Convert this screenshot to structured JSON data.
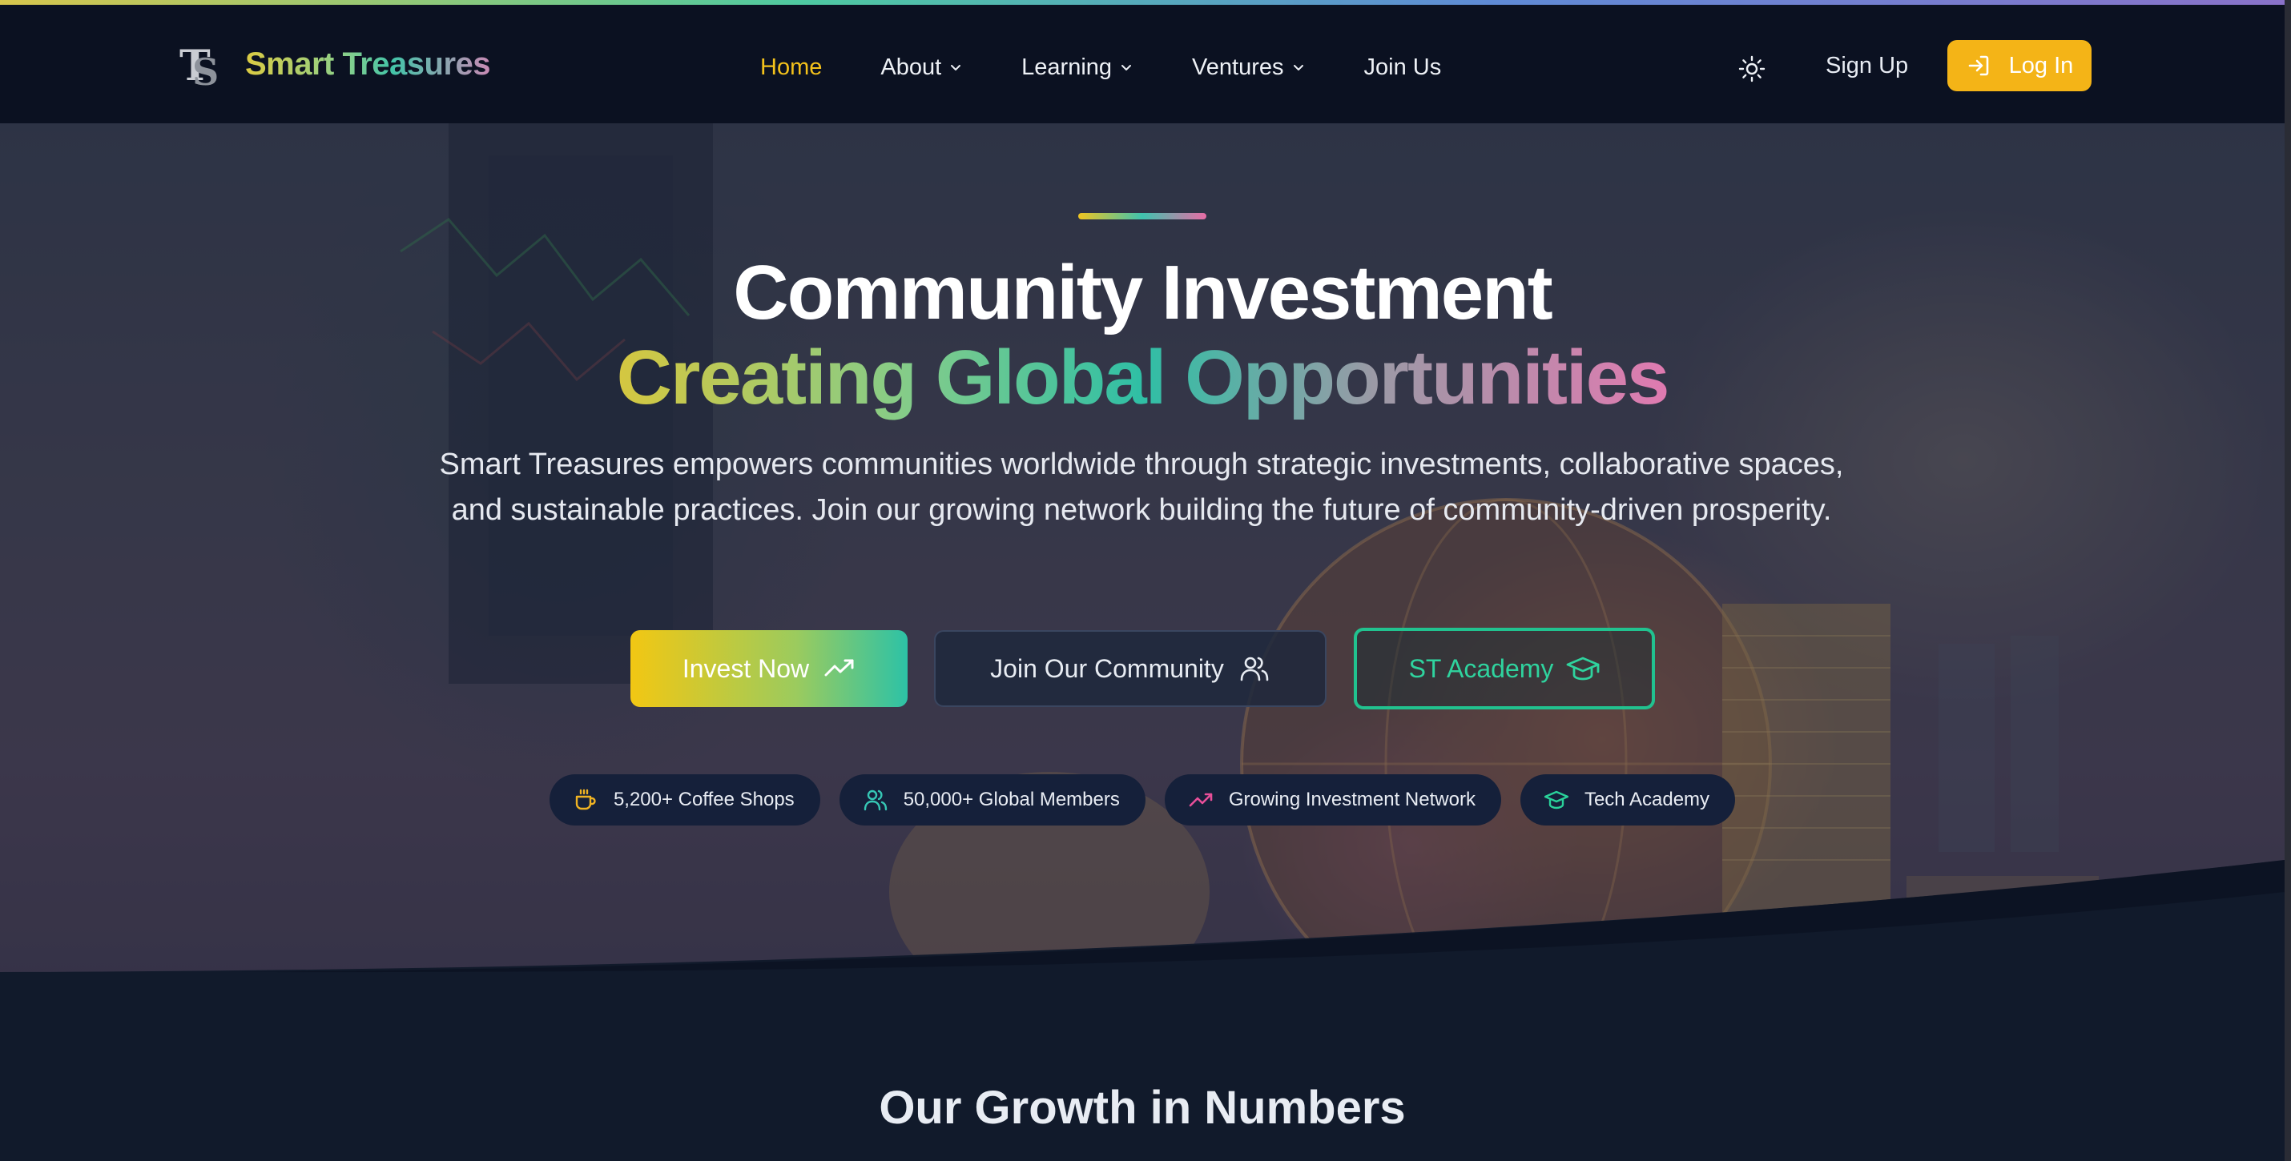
{
  "header": {
    "brand": "Smart Treasures",
    "nav": [
      {
        "label": "Home",
        "active": true,
        "dropdown": false
      },
      {
        "label": "About",
        "dropdown": true
      },
      {
        "label": "Learning",
        "dropdown": true
      },
      {
        "label": "Ventures",
        "dropdown": true
      },
      {
        "label": "Join Us",
        "dropdown": false
      }
    ],
    "theme_toggle_icon": "sun-icon",
    "signup_label": "Sign Up",
    "login_label": "Log In"
  },
  "hero": {
    "title_line1": "Community Investment",
    "title_line2": "Creating Global Opportunities",
    "description": "Smart Treasures empowers communities worldwide through strategic investments, collaborative spaces, and sustainable practices. Join our growing network building the future of community-driven prosperity.",
    "buttons": {
      "invest": "Invest Now",
      "community": "Join Our Community",
      "academy": "ST Academy"
    },
    "pills": [
      {
        "label": "5,200+ Coffee Shops",
        "icon": "coffee-icon",
        "color": "#f0b323"
      },
      {
        "label": "50,000+ Global Members",
        "icon": "users-icon",
        "color": "#36c7b5"
      },
      {
        "label": "Growing Investment Network",
        "icon": "trending-up-icon",
        "color": "#e84f99"
      },
      {
        "label": "Tech Academy",
        "icon": "graduation-cap-icon",
        "color": "#2ad19a"
      }
    ]
  },
  "section": {
    "title": "Our Growth in Numbers"
  },
  "colors": {
    "accent_yellow": "#f4b417",
    "accent_teal": "#21c28f",
    "nav_bg": "#0b1121",
    "page_bg": "#111a2b"
  }
}
